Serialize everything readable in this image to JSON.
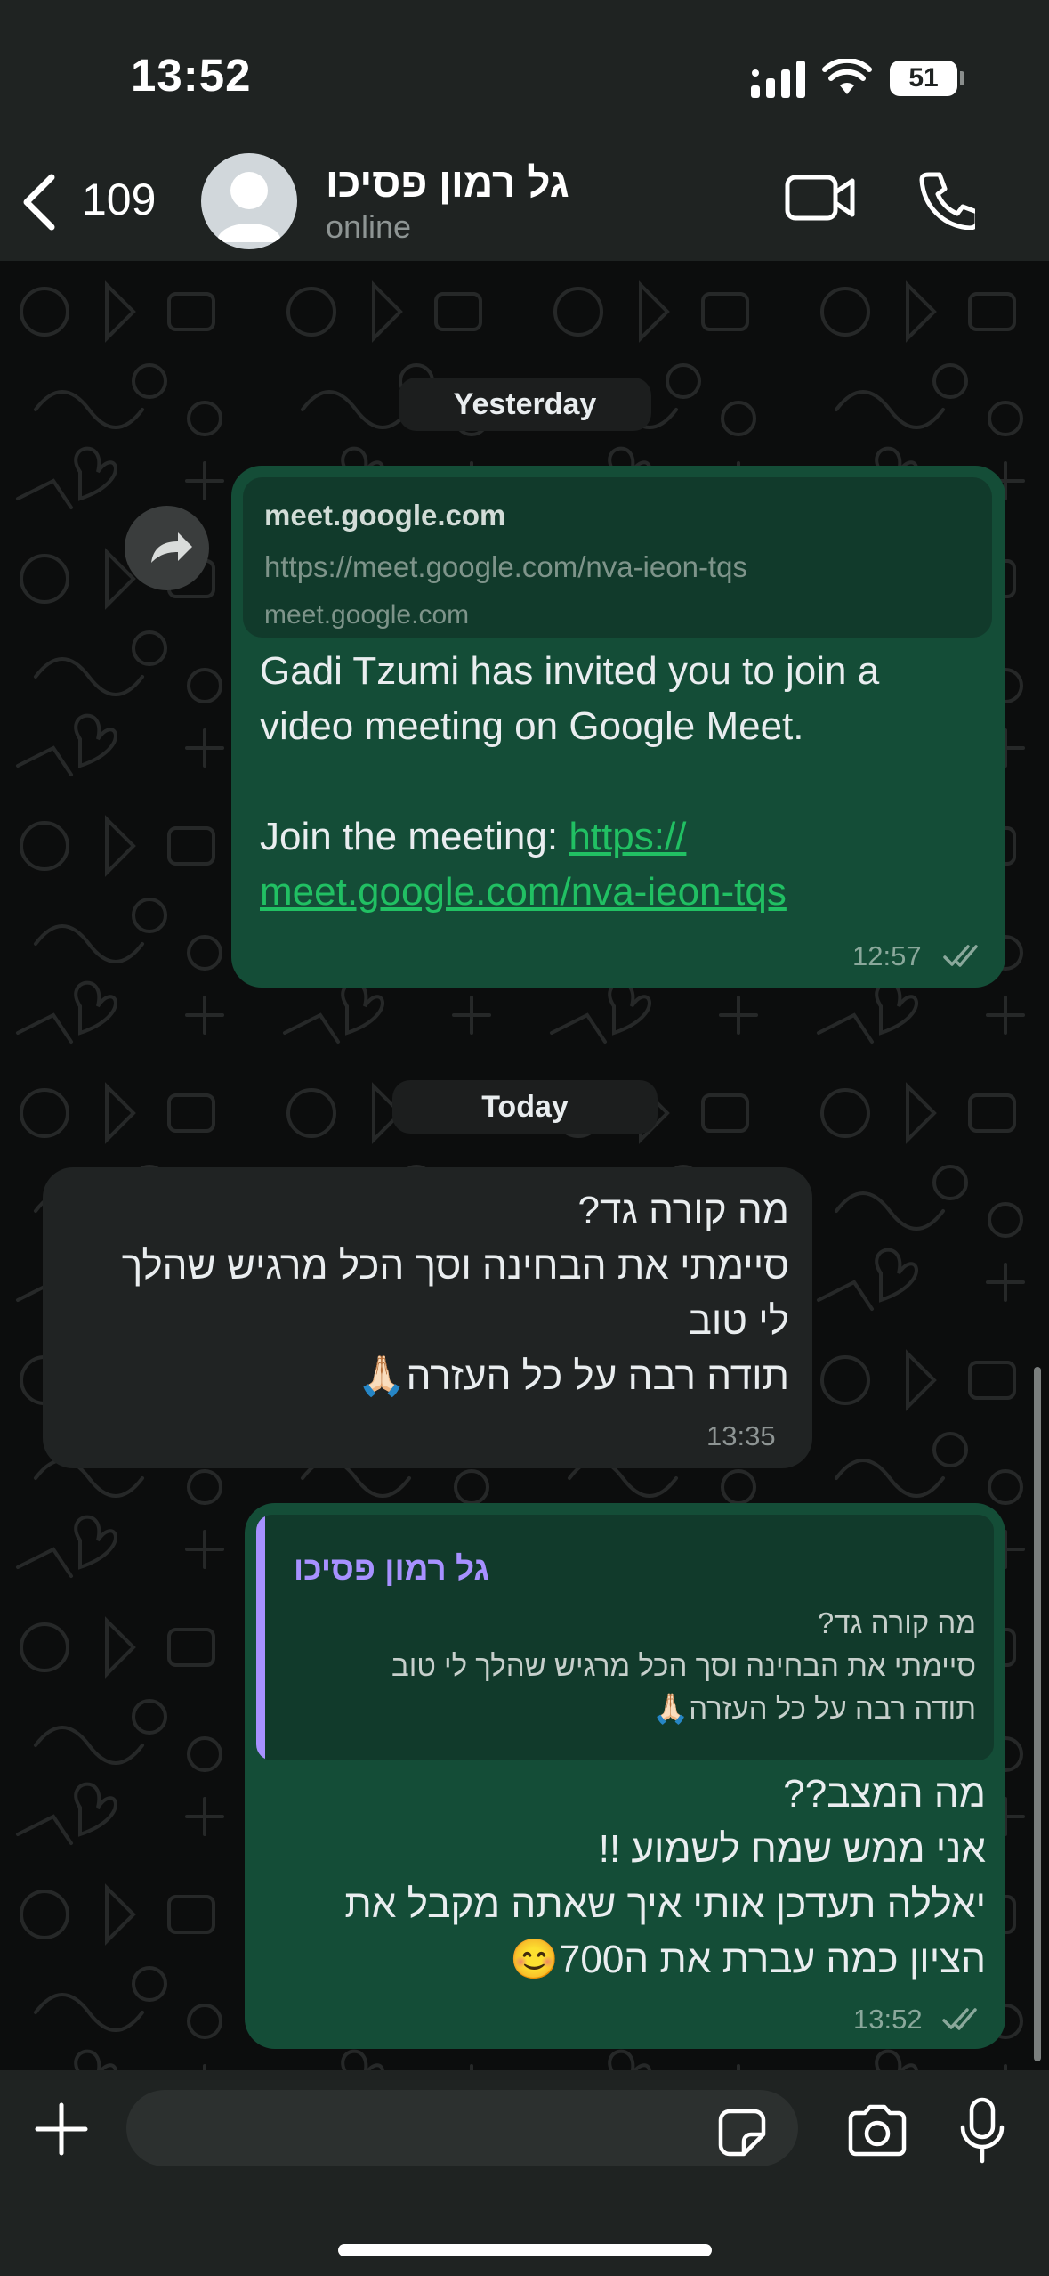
{
  "status_bar": {
    "time": "13:52",
    "battery": "51"
  },
  "header": {
    "back_count": "109",
    "contact_name": "גל רמון פסיכו",
    "contact_status": "online"
  },
  "chat": {
    "date_yesterday": "Yesterday",
    "date_today": "Today",
    "message1": {
      "link_title": "meet.google.com",
      "link_url": "https://meet.google.com/nva-ieon-tqs",
      "link_domain": "meet.google.com",
      "text_line1": "Gadi Tzumi has invited you to join a",
      "text_line2": "video meeting on Google Meet.",
      "join_label": "Join the meeting: ",
      "join_link_part1": "https://",
      "join_link_part2": "meet.google.com/nva-ieon-tqs",
      "time": "12:57"
    },
    "message2": {
      "line1": "מה קורה גד?",
      "line2": "סיימתי את הבחינה וסך הכל מרגיש שהלך",
      "line3": "לי טוב",
      "line4": "תודה רבה על כל העזרה🙏🏻",
      "time": "13:35"
    },
    "message3": {
      "quote_author": "גל רמון פסיכו",
      "quote_line1": "מה קורה גד?",
      "quote_line2": "סיימתי את הבחינה וסך הכל מרגיש שהלך לי טוב",
      "quote_line3": "תודה רבה על כל העזרה🙏🏻",
      "line1": "מה המצב??",
      "line2": "אני ממש שמח  לשמוע !!",
      "line3": "יאללה תעדכן אותי איך שאתה מקבל את",
      "line4": "הציון כמה עברת את ה700😊",
      "time": "13:52"
    }
  },
  "composer": {
    "placeholder": ""
  },
  "colors": {
    "outgoing": "#144d37",
    "incoming": "#202323",
    "link": "#21c063",
    "quote_accent": "#a791ff"
  }
}
